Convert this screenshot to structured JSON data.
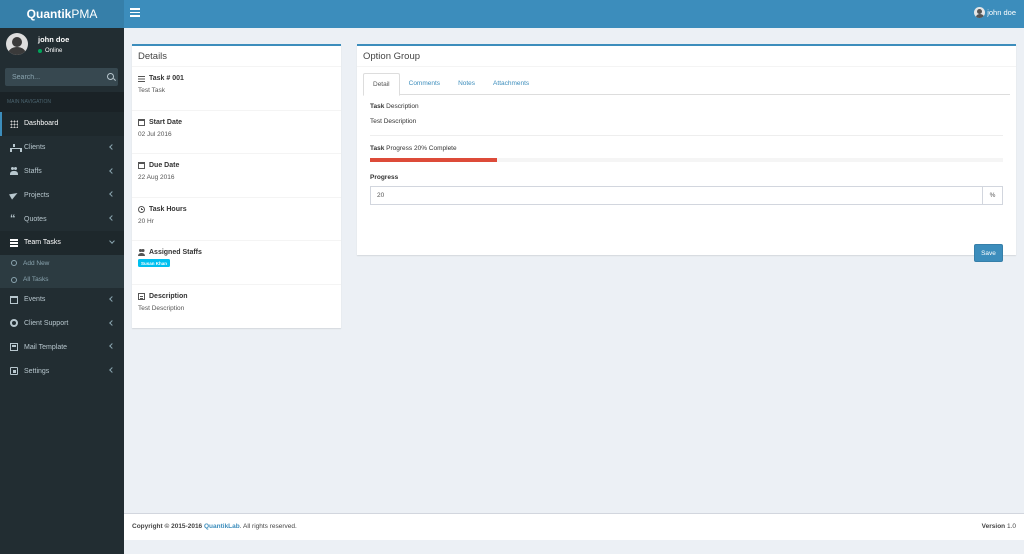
{
  "brand": {
    "strong": "Quantik",
    "light": "PMA"
  },
  "header": {
    "user_name": "john doe"
  },
  "sidebar": {
    "user": {
      "name": "john doe",
      "status": "Online"
    },
    "search": {
      "placeholder": "Search..."
    },
    "nav_header": "MAIN NAVIGATION",
    "items": [
      {
        "label": "Dashboard",
        "icon": "dashboard-icon"
      },
      {
        "label": "Clients",
        "icon": "sitemap-icon"
      },
      {
        "label": "Staffs",
        "icon": "users-icon"
      },
      {
        "label": "Projects",
        "icon": "paper-plane-icon"
      },
      {
        "label": "Quotes",
        "icon": "quote-icon"
      },
      {
        "label": "Team Tasks",
        "icon": "list-icon"
      },
      {
        "label": "Events",
        "icon": "calendar-icon"
      },
      {
        "label": "Client Support",
        "icon": "life-ring-icon"
      },
      {
        "label": "Mail Template",
        "icon": "envelope-icon"
      },
      {
        "label": "Settings",
        "icon": "settings-icon"
      }
    ],
    "team_tasks_sub": [
      {
        "label": "Add New"
      },
      {
        "label": "All Tasks"
      }
    ]
  },
  "details": {
    "title": "Details",
    "rows": [
      {
        "label": "Task # 001",
        "value": "Test Task"
      },
      {
        "label": "Start Date",
        "value": "02 Jul 2016"
      },
      {
        "label": "Due Date",
        "value": "22 Aug 2016"
      },
      {
        "label": "Task Hours",
        "value": "20 Hr"
      },
      {
        "label": "Assigned Staffs",
        "value": "Susan Khan"
      },
      {
        "label": "Description",
        "value": "Test Description"
      }
    ]
  },
  "option_group": {
    "title": "Option Group",
    "tabs": [
      "Detail",
      "Comments",
      "Notes",
      "Attachments"
    ],
    "description_bold": "Task",
    "description_label": " Description",
    "description_value": "Test Description",
    "progress_bold": "Task",
    "progress_label": " Progress 20% Complete",
    "progress_percent": 20,
    "progress_color": "#dd4b39",
    "progress_field_label": "Progress",
    "progress_field_value": "20",
    "progress_addon": "%",
    "save_label": "Save"
  },
  "footer": {
    "copyright": "Copyright © 2015-2016 ",
    "company": "QuantikLab",
    "rights": ". All rights reserved.",
    "version_label": "Version",
    "version_value": " 1.0"
  },
  "colors": {
    "header": "#3c8dbc",
    "logo_bg": "#367fa9",
    "sidebar": "#222d32",
    "badge": "#00c0ef"
  }
}
